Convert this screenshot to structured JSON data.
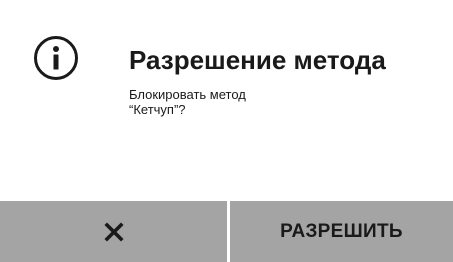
{
  "dialog": {
    "icon": "info-icon",
    "title": "Разрешение метода",
    "message_line1": "Блокировать метод",
    "message_line2": "“Кетчуп”?"
  },
  "buttons": {
    "cancel_icon": "close-icon",
    "allow_label": "РАЗРЕШИТЬ"
  },
  "colors": {
    "button_background": "#a4a4a4",
    "text": "#1a1a1a",
    "background": "#ffffff"
  }
}
